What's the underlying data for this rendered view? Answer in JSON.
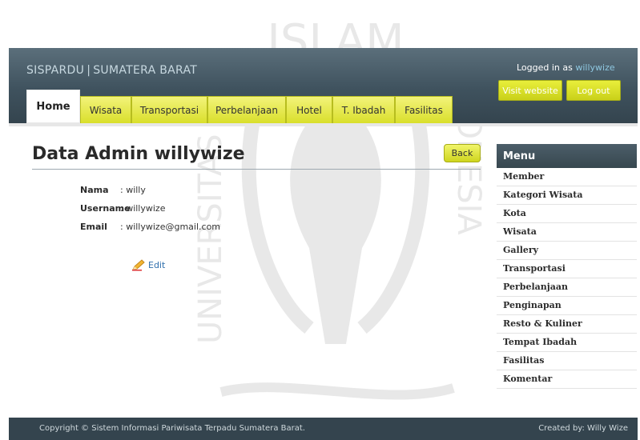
{
  "header": {
    "brand": "SISPARDU",
    "separator": "|",
    "region": "SUMATERA BARAT",
    "logged_in_prefix": "Logged in as",
    "logged_in_user": "willywize",
    "visit_label": "Visit website",
    "logout_label": "Log out"
  },
  "tabs": [
    "Home",
    "Wisata",
    "Transportasi",
    "Perbelanjaan",
    "Hotel",
    "T. Ibadah",
    "Fasilitas"
  ],
  "main": {
    "title": "Data Admin willywize",
    "back_label": "Back",
    "fields": [
      {
        "label": "Nama",
        "value": ": willy"
      },
      {
        "label": "Username",
        "value": ": willywize"
      },
      {
        "label": "Email",
        "value": ": willywize@gmail.com"
      }
    ],
    "edit_label": "Edit"
  },
  "sidebar": {
    "title": "Menu",
    "items": [
      "Member",
      "Kategori Wisata",
      "Kota",
      "Wisata",
      "Gallery",
      "Transportasi",
      "Perbelanjaan",
      "Penginapan",
      "Resto & Kuliner",
      "Tempat Ibadah",
      "Fasilitas",
      "Komentar"
    ]
  },
  "footer": {
    "copyright": "Copyright © Sistem Informasi Pariwisata Terpadu Sumatera Barat.",
    "credit": "Created by: Willy Wize"
  },
  "colors": {
    "header_bg": "#3f525e",
    "tab_yellow": "#d9df2b",
    "link_blue": "#2f6fad",
    "footer_bg": "#34444e"
  },
  "watermark": {
    "text_top": "ISLAM",
    "text_left": "UNIVERSITAS",
    "text_right": "INDONESIA"
  }
}
